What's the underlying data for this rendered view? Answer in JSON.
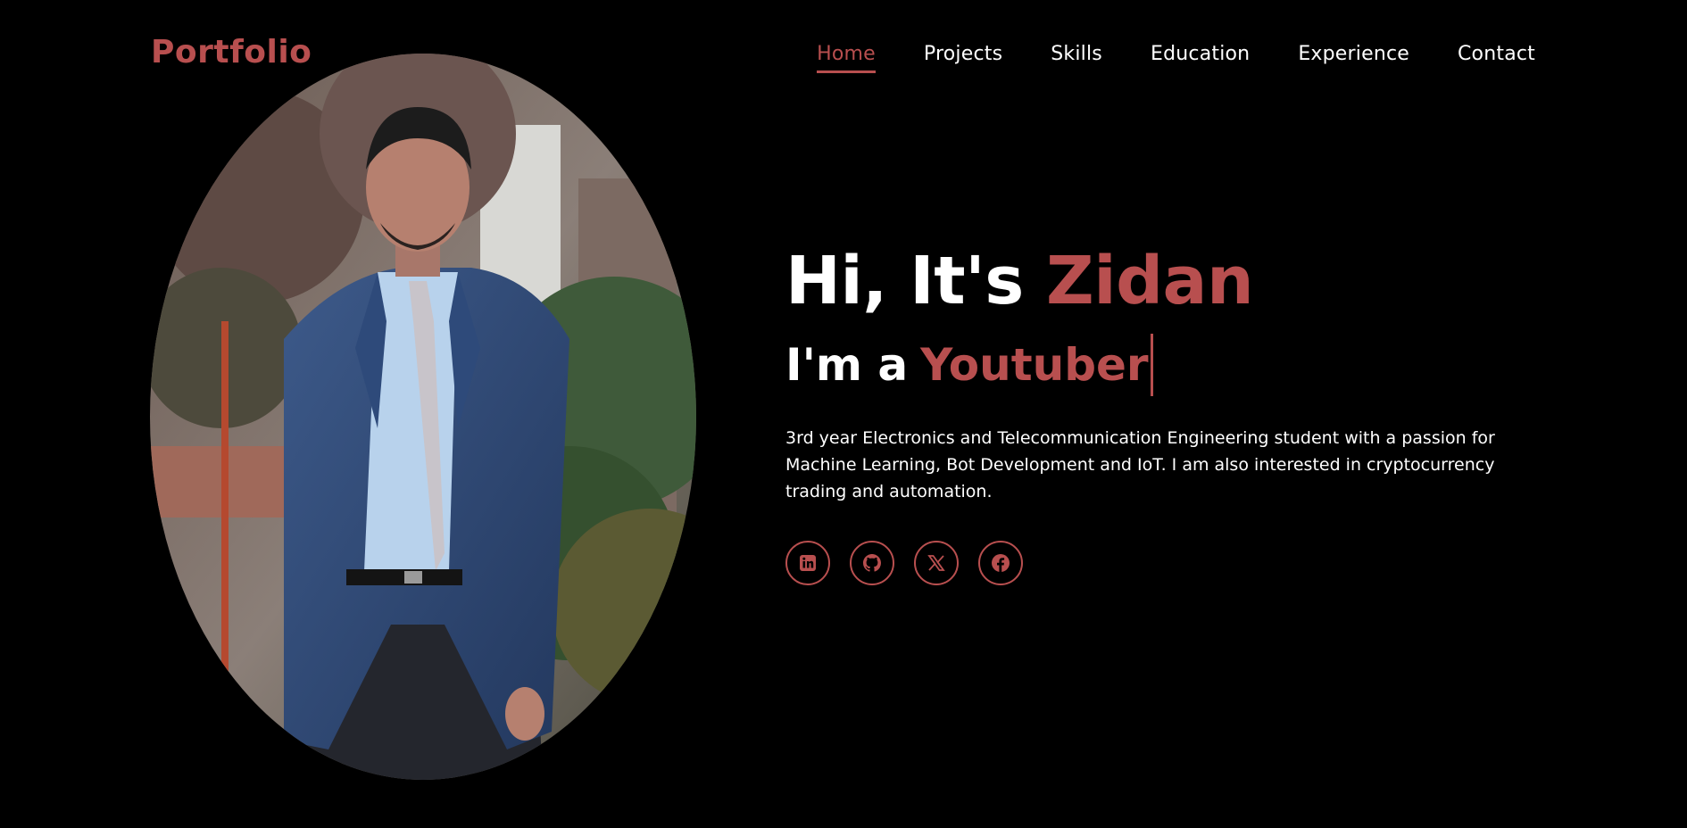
{
  "header": {
    "logo": "Portfolio",
    "nav": [
      {
        "label": "Home",
        "active": true
      },
      {
        "label": "Projects",
        "active": false
      },
      {
        "label": "Skills",
        "active": false
      },
      {
        "label": "Education",
        "active": false
      },
      {
        "label": "Experience",
        "active": false
      },
      {
        "label": "Contact",
        "active": false
      }
    ]
  },
  "hero": {
    "greeting": "Hi, It's",
    "name": "Zidan",
    "role_prefix": "I'm a",
    "role_typed": "Youtuber",
    "bio": "3rd year Electronics and Telecommunication Engineering student with a passion for Machine Learning, Bot Development and IoT. I am also interested in cryptocurrency trading and automation."
  },
  "socials": [
    {
      "icon": "linkedin-icon"
    },
    {
      "icon": "github-icon"
    },
    {
      "icon": "x-icon"
    },
    {
      "icon": "facebook-icon"
    }
  ],
  "colors": {
    "accent": "#b84f4f",
    "background": "#000000",
    "text": "#ffffff"
  }
}
